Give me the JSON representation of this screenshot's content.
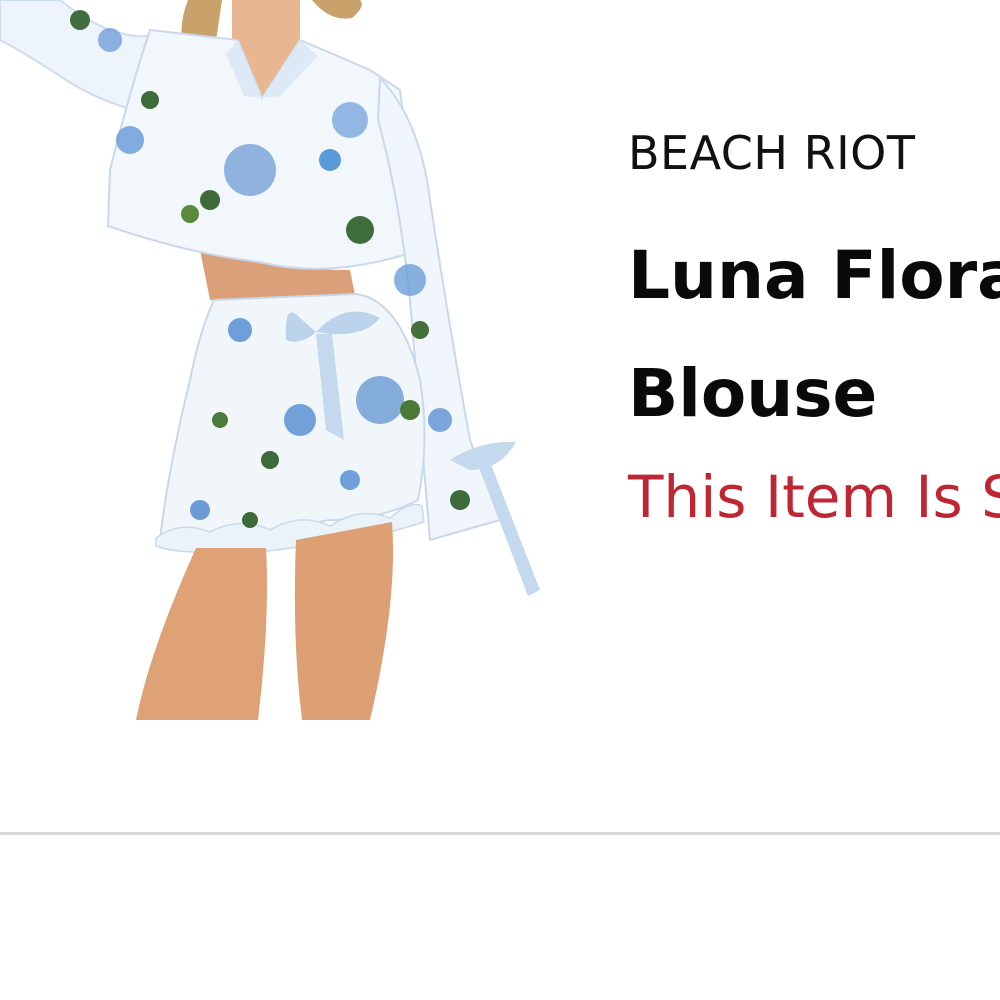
{
  "product": {
    "brand": "BEACH RIOT",
    "title": "Luna Floral Blouse",
    "status": "This Item Is Sold Out"
  },
  "colors": {
    "status": "#bf2633",
    "divider": "#d9d9d9"
  },
  "icons": {
    "image": "product-photo"
  }
}
